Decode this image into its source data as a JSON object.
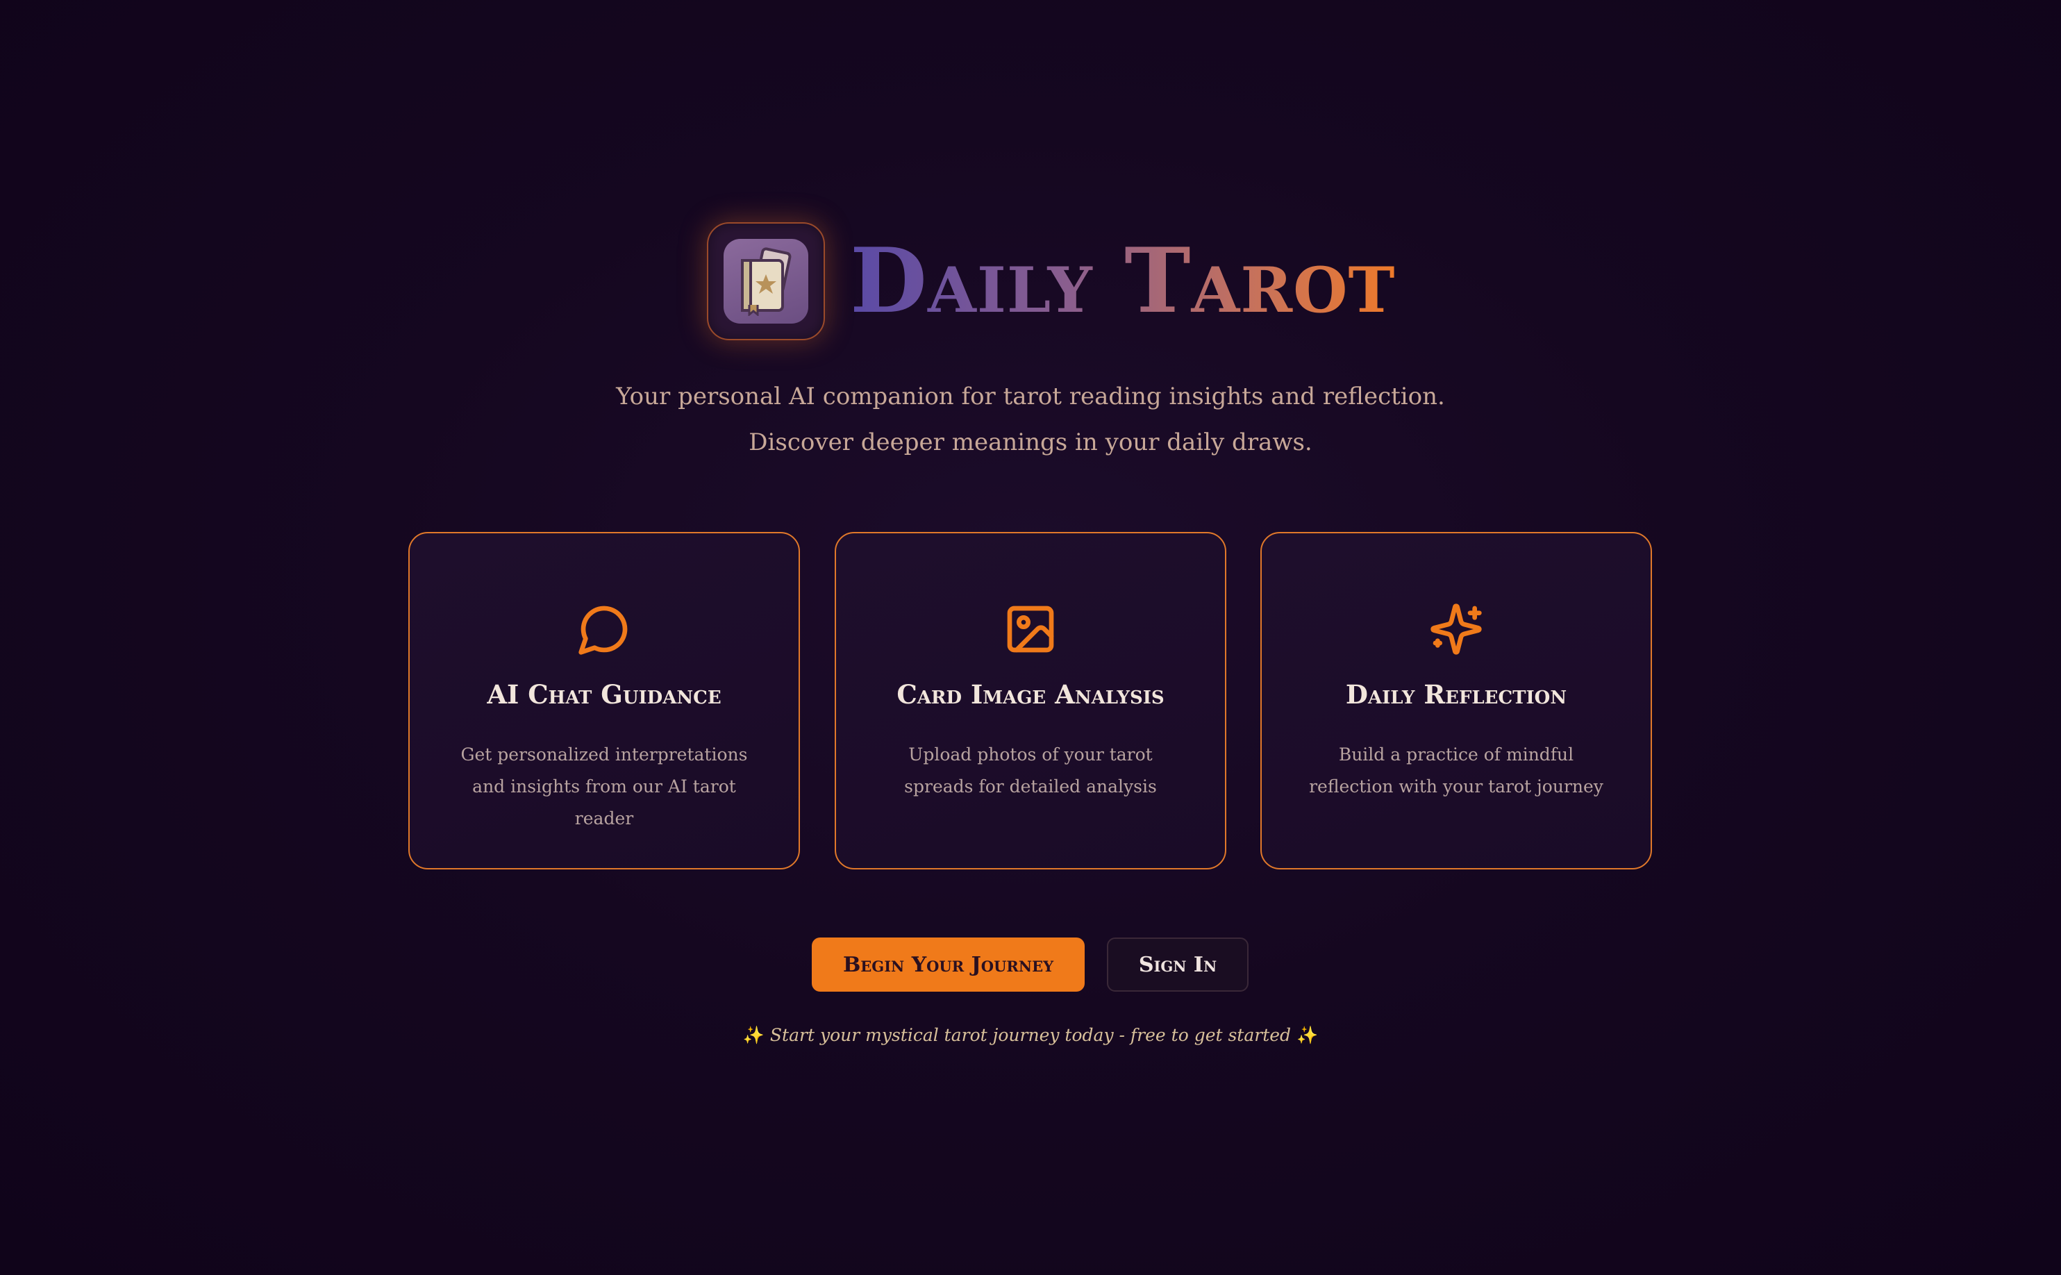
{
  "brand": {
    "title": "Daily Tarot",
    "logo_icon": "tarot-book-icon"
  },
  "tagline": "Your personal AI companion for tarot reading insights and reflection. Discover deeper meanings in your daily draws.",
  "features": [
    {
      "icon": "chat-bubble-icon",
      "title": "AI Chat Guidance",
      "description": "Get personalized interpretations and insights from our AI tarot reader"
    },
    {
      "icon": "image-icon",
      "title": "Card Image Analysis",
      "description": "Upload photos of your tarot spreads for detailed analysis"
    },
    {
      "icon": "sparkles-icon",
      "title": "Daily Reflection",
      "description": "Build a practice of mindful reflection with your tarot journey"
    }
  ],
  "actions": {
    "primary_label": "Begin Your Journey",
    "secondary_label": "Sign In"
  },
  "footnote": {
    "spark_left": "✨",
    "text": "Start your mystical tarot journey today - free to get started",
    "spark_right": "✨"
  },
  "colors": {
    "accent": "#f07a1a",
    "background": "#150720",
    "card_border": "#e0782a"
  }
}
